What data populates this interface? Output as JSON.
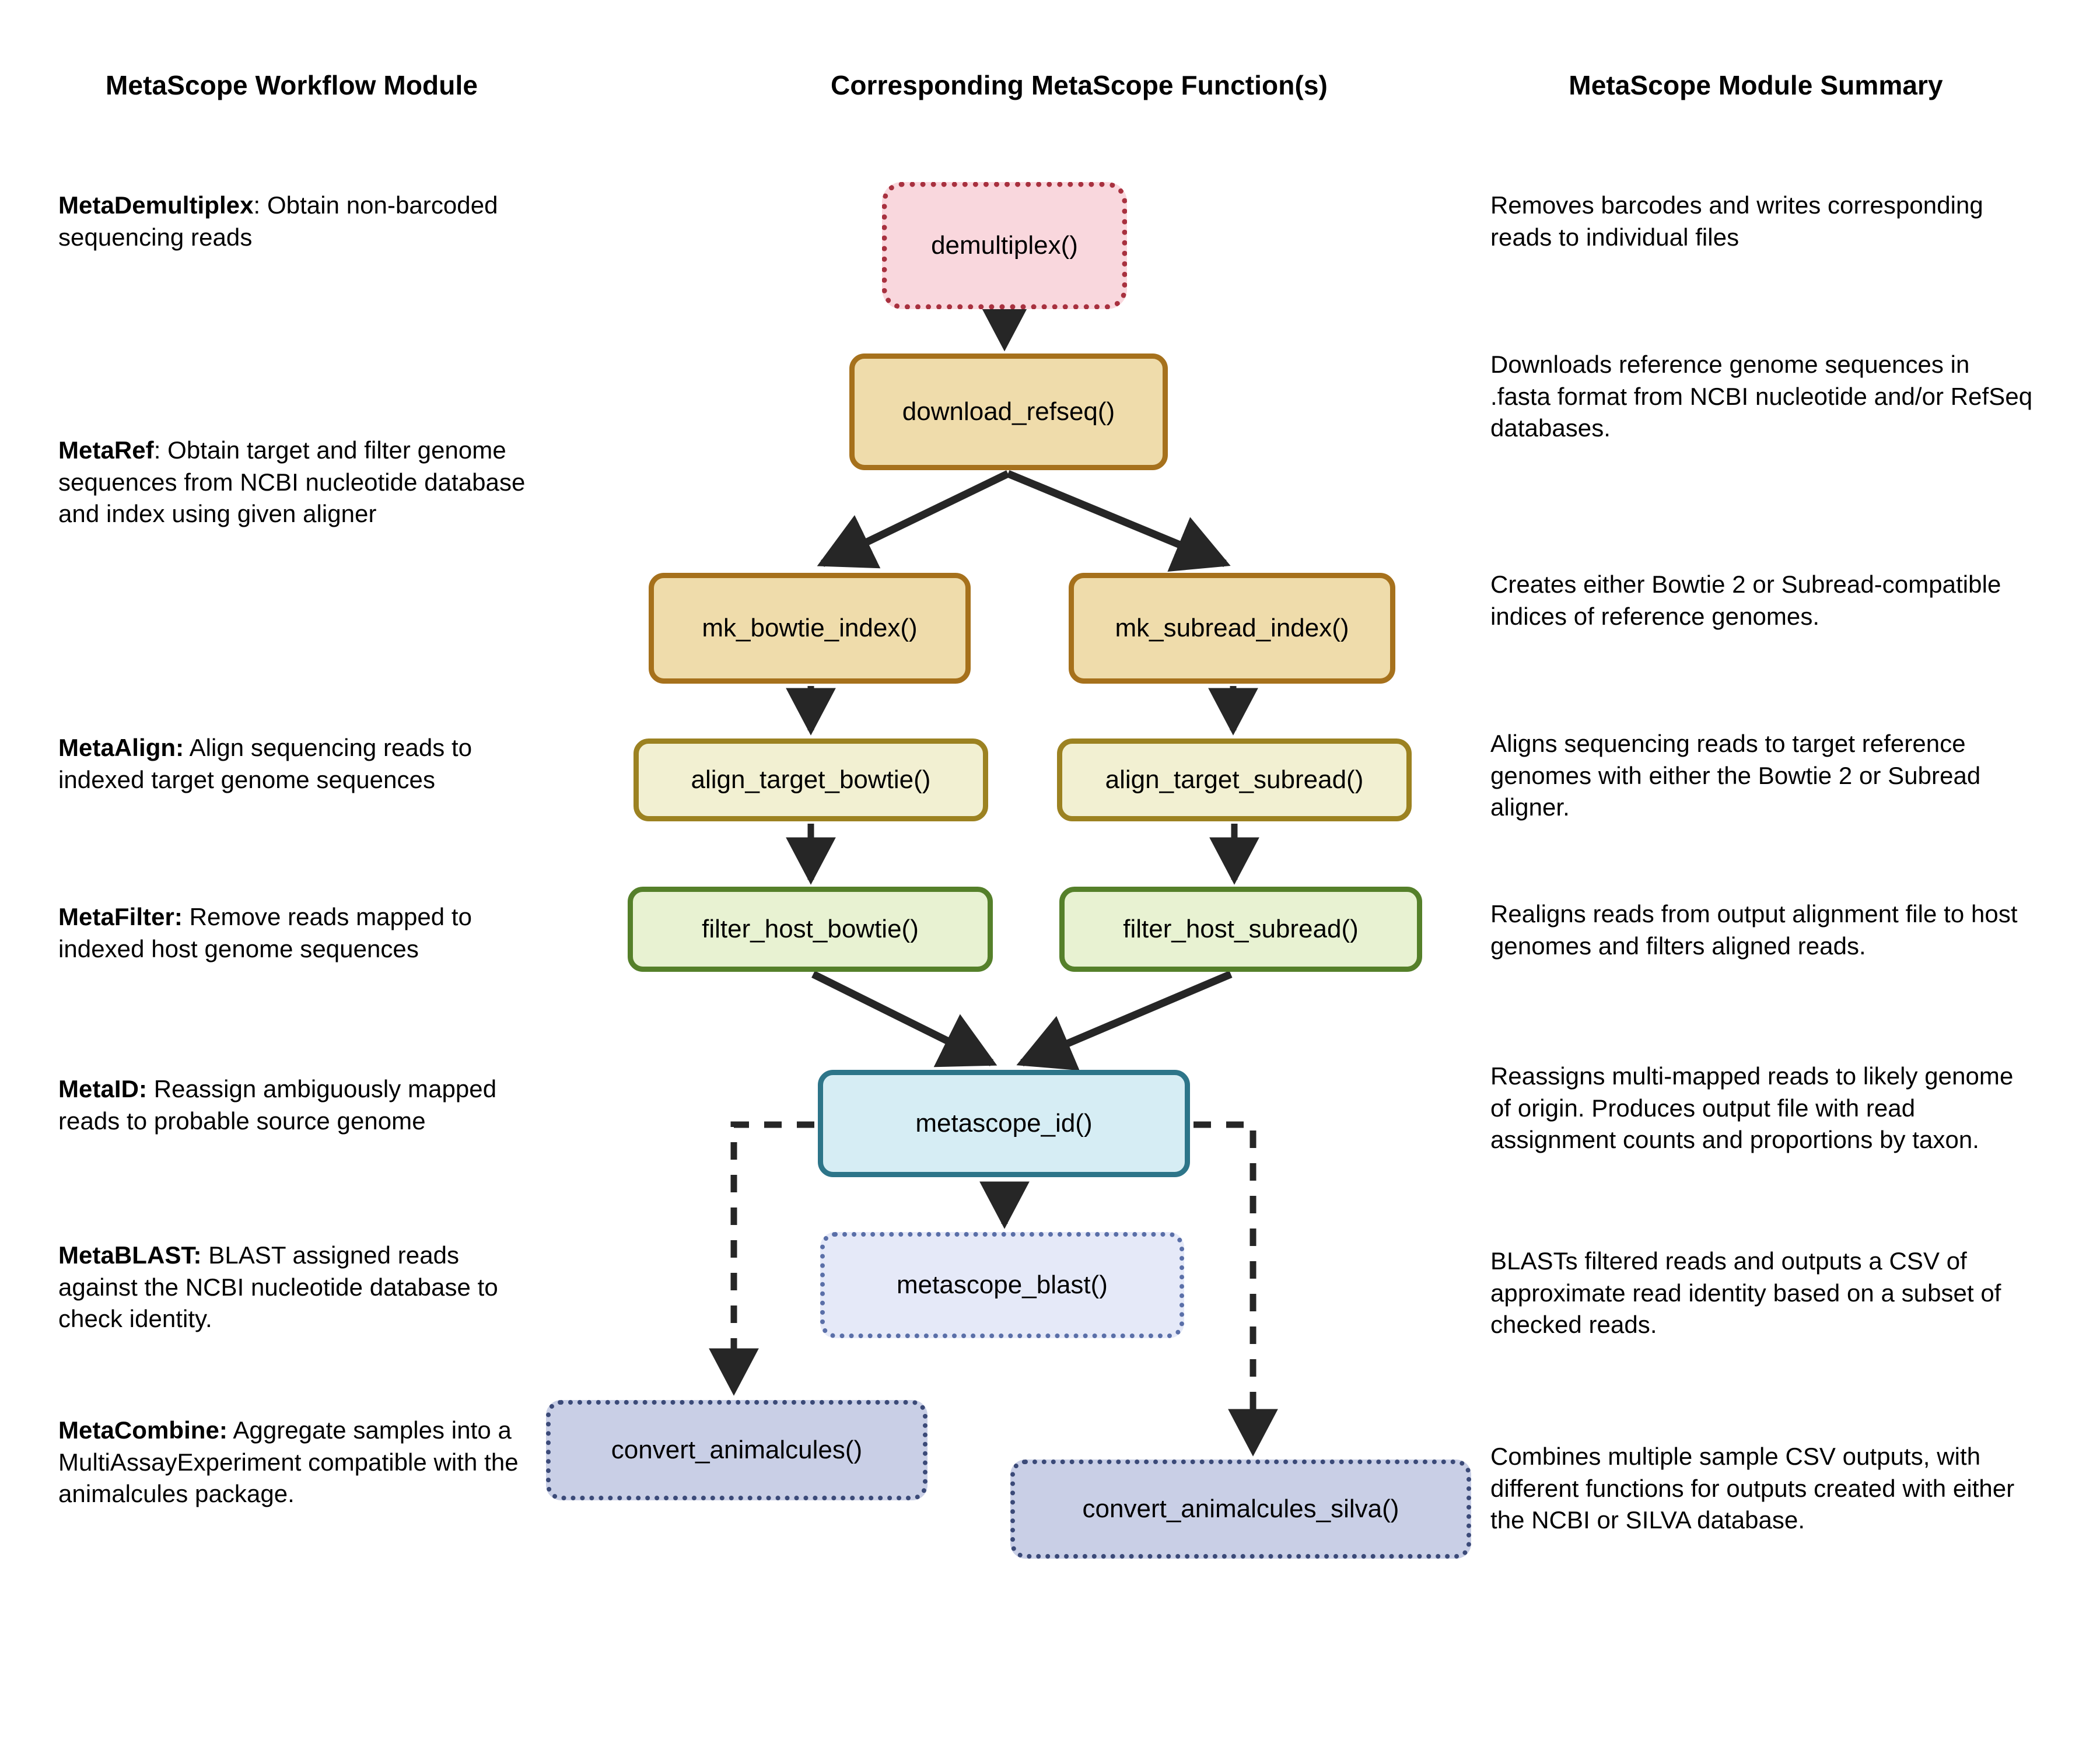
{
  "headers": {
    "left": "MetaScope Workflow Module",
    "middle": "Corresponding MetaScope Function(s)",
    "right": "MetaScope Module Summary"
  },
  "modules": [
    {
      "name": "MetaDemultiplex",
      "sep": ": ",
      "desc": "Obtain non-barcoded sequencing reads"
    },
    {
      "name": "MetaRef",
      "sep": ": ",
      "desc": "Obtain target and filter genome sequences from NCBI nucleotide database and index using given aligner"
    },
    {
      "name": "MetaAlign:",
      "sep": " ",
      "desc": "Align sequencing reads to indexed target genome sequences"
    },
    {
      "name": "MetaFilter:",
      "sep": " ",
      "desc": "Remove reads mapped to indexed host genome sequences"
    },
    {
      "name": "MetaID:",
      "sep": " ",
      "desc": "Reassign ambiguously mapped reads to probable source genome"
    },
    {
      "name": "MetaBLAST:",
      "sep": " ",
      "desc": "BLAST assigned reads against the NCBI nucleotide database to check identity."
    },
    {
      "name": "MetaCombine:",
      "sep": " ",
      "desc": "Aggregate samples into a MultiAssayExperiment compatible with the animalcules package."
    }
  ],
  "summaries": [
    "Removes barcodes and writes corresponding reads to individual files",
    "Downloads reference genome sequences in .fasta format from NCBI nucleotide and/or RefSeq databases.",
    "Creates either Bowtie 2 or Subread-compatible indices of reference genomes.",
    "Aligns sequencing reads to target reference genomes with either the Bowtie 2 or Subread aligner.",
    "Realigns reads from output alignment file to host genomes and filters aligned reads.",
    "Reassigns multi-mapped reads to likely genome of origin. Produces output file with read assignment counts and proportions by taxon.",
    "BLASTs filtered reads and outputs a CSV of approximate read identity based on a subset of checked reads.",
    "Combines multiple sample CSV outputs, with different functions for outputs created with either the NCBI or SILVA database."
  ],
  "nodes": {
    "demultiplex": "demultiplex()",
    "download_refseq": "download_refseq()",
    "mk_bowtie_index": "mk_bowtie_index()",
    "mk_subread_index": "mk_subread_index()",
    "align_target_bowtie": "align_target_bowtie()",
    "align_target_subread": "align_target_subread()",
    "filter_host_bowtie": "filter_host_bowtie()",
    "filter_host_subread": "filter_host_subread()",
    "metascope_id": "metascope_id()",
    "metascope_blast": "metascope_blast()",
    "convert_animalcules": "convert_animalcules()",
    "convert_animalcules_silva": "convert_animalcules_silva()"
  },
  "colors": {
    "demultiplex_fill": "#f9d7dd",
    "demultiplex_border": "#a8313f",
    "refseq_fill": "#efdcab",
    "refseq_border": "#a6711c",
    "align_fill": "#f2f0d2",
    "align_border": "#9c8221",
    "filter_fill": "#e8f2d2",
    "filter_border": "#55802a",
    "id_fill": "#d6edf4",
    "id_border": "#2d7589",
    "blast_fill": "#e5e9f8",
    "blast_border": "#5a6fa8",
    "convert_fill": "#c9cfe6",
    "convert_border": "#3b4a78",
    "arrow": "#262626",
    "background": "#ffffff"
  }
}
